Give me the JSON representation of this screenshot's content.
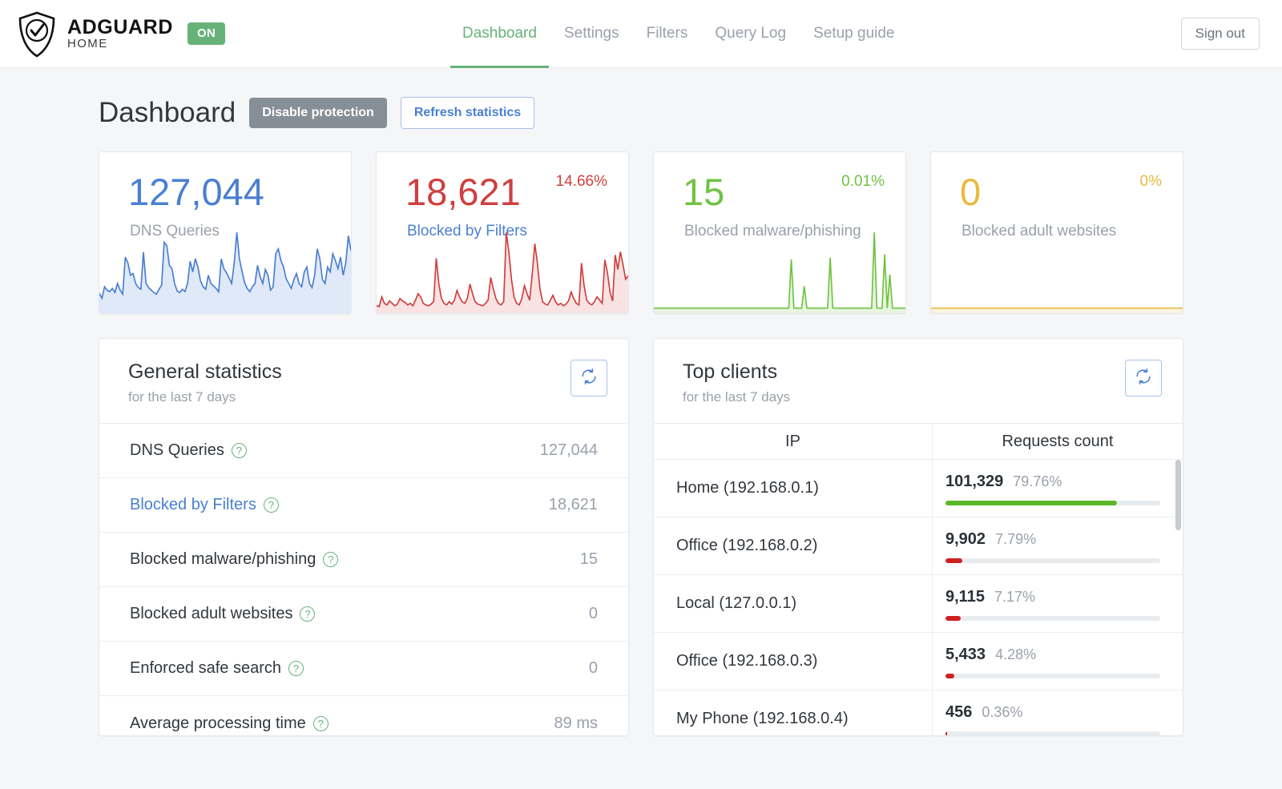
{
  "header": {
    "brand_main": "ADGUARD",
    "brand_sub": "HOME",
    "status_badge": "ON",
    "signout_label": "Sign out",
    "nav": [
      {
        "label": "Dashboard",
        "active": true
      },
      {
        "label": "Settings",
        "active": false
      },
      {
        "label": "Filters",
        "active": false
      },
      {
        "label": "Query Log",
        "active": false
      },
      {
        "label": "Setup guide",
        "active": false
      }
    ]
  },
  "page": {
    "title": "Dashboard",
    "disable_protection_label": "Disable protection",
    "refresh_statistics_label": "Refresh statistics"
  },
  "stat_cards": [
    {
      "value": "127,044",
      "percent": "",
      "label": "DNS Queries",
      "color": "#4a7fd1",
      "link": false
    },
    {
      "value": "18,621",
      "percent": "14.66%",
      "label": "Blocked by Filters",
      "color": "#cf3f3f",
      "link": true
    },
    {
      "value": "15",
      "percent": "0.01%",
      "label": "Blocked malware/phishing",
      "color": "#71c243",
      "link": false
    },
    {
      "value": "0",
      "percent": "0%",
      "label": "Blocked adult websites",
      "color": "#e9b942",
      "link": false
    }
  ],
  "general_statistics": {
    "title": "General statistics",
    "subtitle": "for the last 7 days",
    "refresh_icon": "refresh-icon",
    "help_icon": "question-mark-icon",
    "rows": [
      {
        "name": "DNS Queries",
        "value": "127,044",
        "link": false
      },
      {
        "name": "Blocked by Filters",
        "value": "18,621",
        "link": true
      },
      {
        "name": "Blocked malware/phishing",
        "value": "15",
        "link": false
      },
      {
        "name": "Blocked adult websites",
        "value": "0",
        "link": false
      },
      {
        "name": "Enforced safe search",
        "value": "0",
        "link": false
      },
      {
        "name": "Average processing time",
        "value": "89 ms",
        "link": false
      }
    ]
  },
  "top_clients": {
    "title": "Top clients",
    "subtitle": "for the last 7 days",
    "refresh_icon": "refresh-icon",
    "columns": [
      "IP",
      "Requests count"
    ],
    "rows": [
      {
        "name": "Home",
        "address": "(192.168.0.1)",
        "count": "101,329",
        "percent": "79.76%",
        "bar_pct": 79.76,
        "bar_color": "#5ab726"
      },
      {
        "name": "Office",
        "address": "(192.168.0.2)",
        "count": "9,902",
        "percent": "7.79%",
        "bar_pct": 7.79,
        "bar_color": "#cf2020"
      },
      {
        "name": "Local",
        "address": "(127.0.0.1)",
        "count": "9,115",
        "percent": "7.17%",
        "bar_pct": 7.17,
        "bar_color": "#cf2020"
      },
      {
        "name": "Office",
        "address": "(192.168.0.3)",
        "count": "5,433",
        "percent": "4.28%",
        "bar_pct": 4.28,
        "bar_color": "#cf2020"
      },
      {
        "name": "My Phone",
        "address": "(192.168.0.4)",
        "count": "456",
        "percent": "0.36%",
        "bar_pct": 0.36,
        "bar_color": "#cf2020"
      }
    ]
  },
  "chart_data": [
    {
      "type": "area",
      "title": "DNS Queries",
      "color": "#4a7fd1",
      "ylim": [
        0,
        100
      ],
      "values": [
        18,
        12,
        26,
        22,
        20,
        24,
        19,
        30,
        22,
        17,
        62,
        55,
        40,
        42,
        30,
        25,
        23,
        68,
        30,
        25,
        22,
        19,
        17,
        23,
        28,
        80,
        76,
        52,
        48,
        30,
        21,
        19,
        23,
        20,
        30,
        57,
        44,
        60,
        50,
        33,
        26,
        23,
        40,
        30,
        27,
        24,
        20,
        60,
        48,
        43,
        37,
        30,
        55,
        92,
        60,
        45,
        31,
        24,
        20,
        26,
        30,
        52,
        38,
        30,
        47,
        40,
        22,
        26,
        66,
        72,
        58,
        50,
        36,
        30,
        24,
        35,
        42,
        30,
        26,
        44,
        50,
        30,
        25,
        40,
        72,
        60,
        35,
        30,
        50,
        44,
        66,
        58,
        48,
        62,
        40,
        55,
        88,
        70
      ]
    },
    {
      "type": "area",
      "title": "Blocked by Filters",
      "color": "#cf3f3f",
      "ylim": [
        0,
        100
      ],
      "values": [
        3,
        2,
        14,
        6,
        4,
        9,
        6,
        3,
        5,
        12,
        9,
        7,
        4,
        6,
        3,
        10,
        18,
        14,
        6,
        4,
        3,
        5,
        8,
        62,
        30,
        12,
        6,
        4,
        8,
        5,
        10,
        22,
        14,
        8,
        6,
        12,
        30,
        18,
        8,
        5,
        4,
        3,
        6,
        10,
        38,
        24,
        12,
        6,
        4,
        8,
        94,
        70,
        36,
        14,
        6,
        4,
        12,
        28,
        18,
        10,
        42,
        80,
        56,
        24,
        8,
        5,
        4,
        10,
        16,
        8,
        4,
        6,
        3,
        5,
        9,
        20,
        12,
        6,
        4,
        56,
        28,
        10,
        6,
        4,
        8,
        14,
        10,
        6,
        60,
        44,
        20,
        9,
        66,
        48,
        70,
        54,
        36,
        40
      ]
    },
    {
      "type": "area",
      "title": "Blocked malware/phishing",
      "color": "#71c243",
      "ylim": [
        0,
        100
      ],
      "values": [
        0,
        0,
        0,
        0,
        0,
        0,
        0,
        0,
        0,
        0,
        0,
        0,
        0,
        0,
        0,
        0,
        0,
        0,
        0,
        0,
        0,
        0,
        0,
        0,
        0,
        0,
        0,
        0,
        0,
        0,
        0,
        0,
        0,
        0,
        0,
        0,
        0,
        0,
        0,
        0,
        0,
        0,
        0,
        0,
        0,
        0,
        0,
        0,
        0,
        0,
        0,
        0,
        0,
        58,
        0,
        0,
        0,
        0,
        26,
        0,
        0,
        0,
        0,
        0,
        0,
        0,
        0,
        0,
        60,
        0,
        0,
        0,
        0,
        0,
        0,
        0,
        0,
        0,
        0,
        0,
        0,
        0,
        0,
        0,
        0,
        90,
        0,
        0,
        0,
        64,
        0,
        40,
        0,
        0,
        0,
        0,
        0,
        0
      ]
    },
    {
      "type": "area",
      "title": "Blocked adult websites",
      "color": "#e9b942",
      "ylim": [
        0,
        100
      ],
      "values": [
        0,
        0,
        0,
        0,
        0,
        0,
        0,
        0,
        0,
        0,
        0,
        0,
        0,
        0,
        0,
        0,
        0,
        0,
        0,
        0,
        0,
        0,
        0,
        0,
        0,
        0,
        0,
        0,
        0,
        0,
        0,
        0,
        0,
        0,
        0,
        0,
        0,
        0,
        0,
        0,
        0,
        0,
        0,
        0,
        0,
        0,
        0,
        0,
        0,
        0,
        0,
        0,
        0,
        0,
        0,
        0,
        0,
        0,
        0,
        0,
        0,
        0,
        0,
        0,
        0,
        0,
        0,
        0,
        0,
        0,
        0,
        0,
        0,
        0,
        0,
        0,
        0,
        0,
        0,
        0,
        0,
        0,
        0,
        0,
        0,
        0,
        0,
        0,
        0,
        0,
        0,
        0,
        0,
        0,
        0,
        0,
        0,
        0
      ]
    }
  ]
}
